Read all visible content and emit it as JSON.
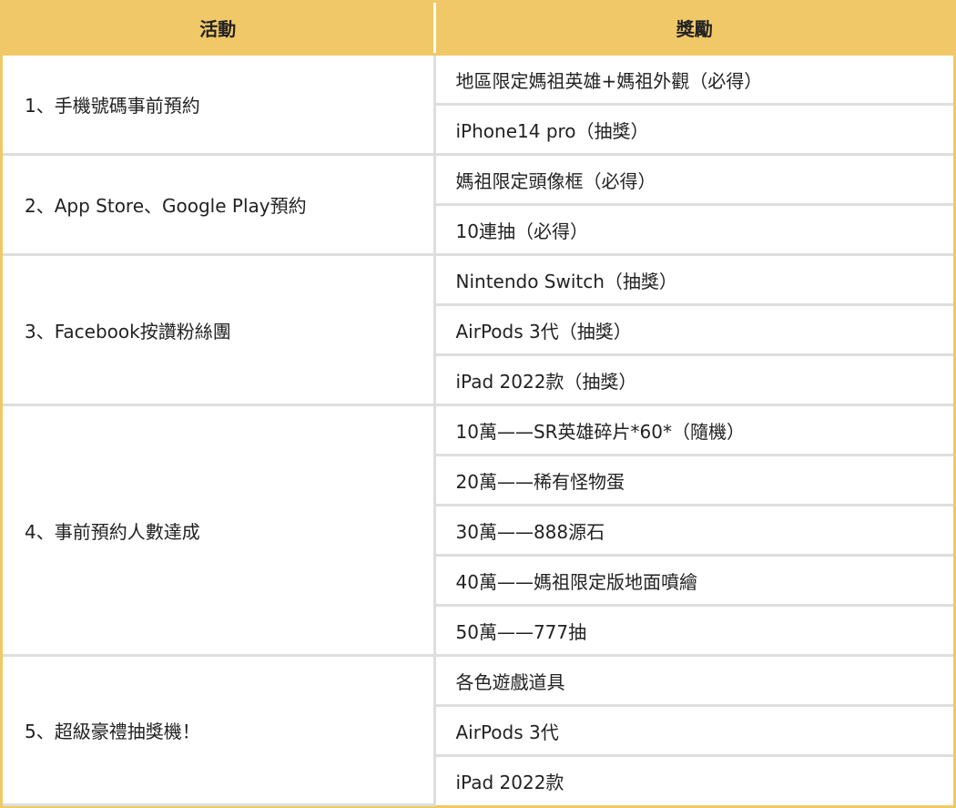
{
  "header": {
    "activity": "活動",
    "reward": "獎勵"
  },
  "groups": [
    {
      "activity": "1、手機號碼事前預約",
      "rewards": [
        "地區限定媽祖英雄+媽祖外觀（必得）",
        "iPhone14 pro（抽獎）"
      ]
    },
    {
      "activity": "2、App Store、Google Play預約",
      "rewards": [
        "媽祖限定頭像框（必得）",
        "10連抽（必得）"
      ]
    },
    {
      "activity": "3、Facebook按讚粉絲團",
      "rewards": [
        "Nintendo Switch（抽獎）",
        "AirPods 3代（抽獎）",
        "iPad 2022款（抽獎）"
      ]
    },
    {
      "activity": "4、事前預約人數達成",
      "rewards": [
        "10萬——SR英雄碎片*60*（隨機）",
        "20萬——稀有怪物蛋",
        "30萬——888源石",
        "40萬——媽祖限定版地面噴繪",
        "50萬——777抽"
      ]
    },
    {
      "activity": "5、超級豪禮抽獎機！",
      "rewards": [
        "各色遊戲道具",
        "AirPods 3代",
        "iPad 2022款"
      ]
    }
  ],
  "colors": {
    "header_bg": "#f0c868",
    "grid": "#dedede",
    "text": "#222222"
  }
}
